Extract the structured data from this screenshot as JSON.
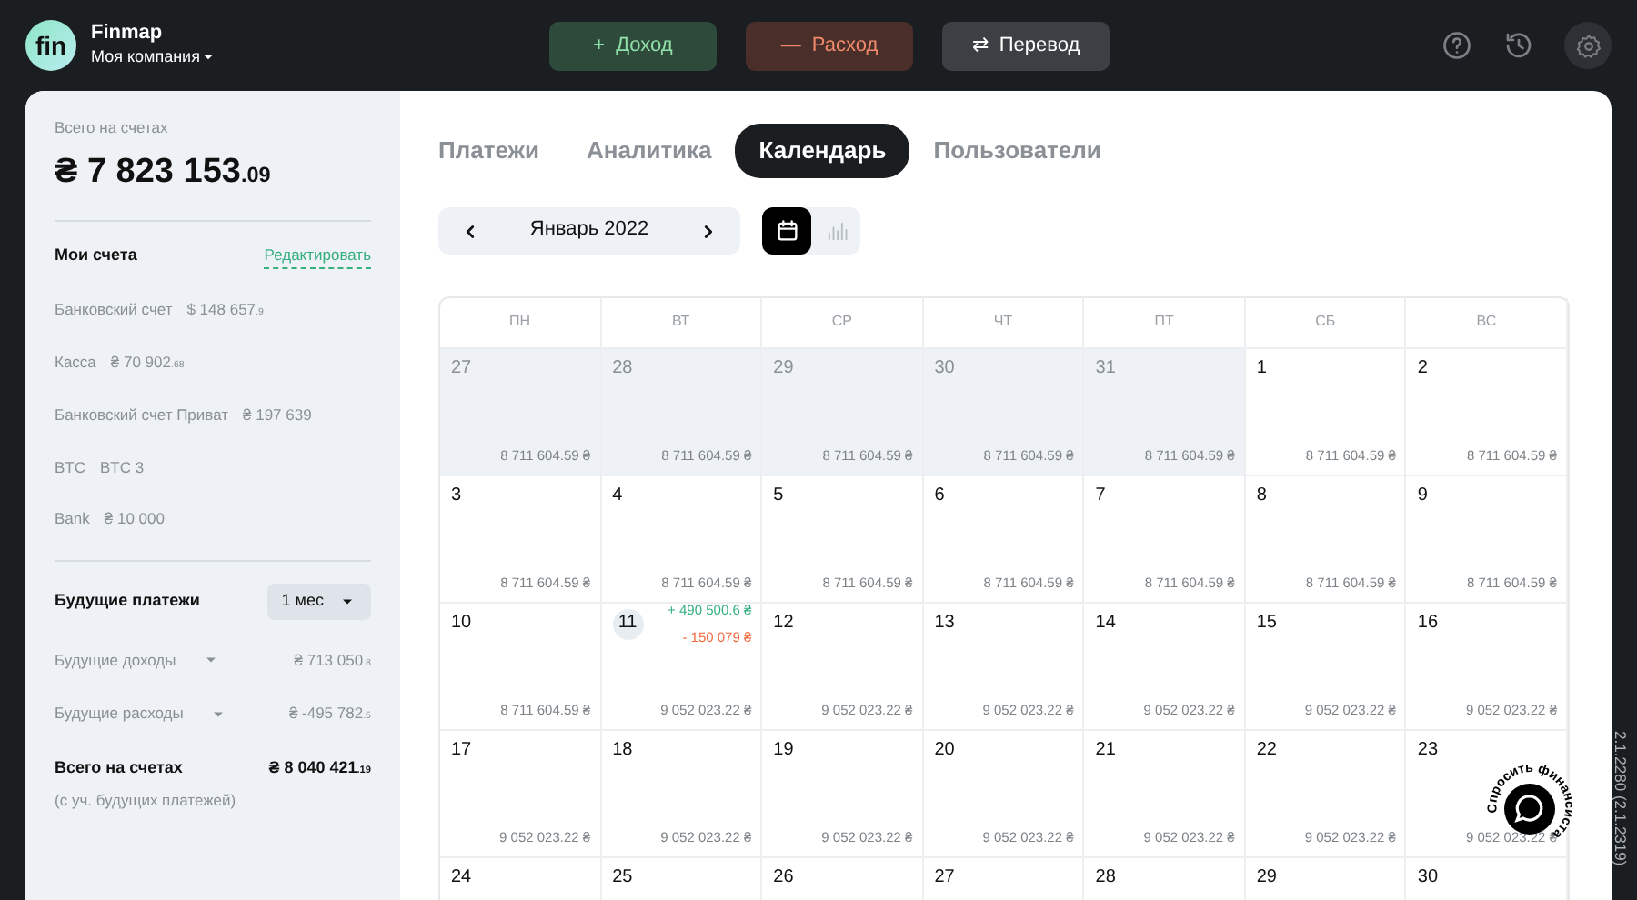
{
  "app": {
    "logo": "fin",
    "name": "Finmap",
    "company": "Моя компания"
  },
  "actions": [
    {
      "kind": "income",
      "label": "Доход",
      "icon": "+"
    },
    {
      "kind": "expense",
      "label": "Расход",
      "icon": "—"
    },
    {
      "kind": "transfer",
      "label": "Перевод",
      "icon": "⇄"
    }
  ],
  "sidebar": {
    "total_label": "Всего на счетах",
    "total": "₴ 7 823 153",
    "total_cents": ".09",
    "accounts_title": "Мои счета",
    "edit_link": "Редактировать",
    "accounts": [
      {
        "name": "Банковский счет",
        "amount": "$ 148 657",
        "cents": ".9"
      },
      {
        "name": "Касса",
        "amount": "₴ 70 902",
        "cents": ".68"
      },
      {
        "name": "Банковский счет Приват",
        "amount": "₴ 197 639"
      },
      {
        "name": "BTC",
        "amount": "BTC 3"
      },
      {
        "name": "Bank",
        "amount": "₴ 10 000"
      }
    ],
    "future_title": "Будущие платежи",
    "period": "1 мес",
    "future": [
      {
        "label": "Будущие доходы",
        "amount": "₴ 713 050",
        "cents": ".8"
      },
      {
        "label": "Будущие расходы",
        "amount": "₴ -495 782",
        "cents": ".5"
      }
    ],
    "grand_label": "Всего на счетах",
    "grand": "₴ 8 040 421",
    "grand_cents": ".19",
    "grand_note": "(с уч. будущих платежей)"
  },
  "tabs": [
    {
      "label": "Платежи",
      "selected": false
    },
    {
      "label": "Аналитика",
      "selected": false
    },
    {
      "label": "Календарь",
      "selected": true
    },
    {
      "label": "Пользователи",
      "selected": false
    }
  ],
  "month": "Январь 2022",
  "views": [
    {
      "kind": "calendar",
      "selected": true
    },
    {
      "kind": "chart",
      "selected": false
    }
  ],
  "weekdays": [
    "ПН",
    "ВТ",
    "СР",
    "ЧТ",
    "ПТ",
    "СБ",
    "ВС"
  ],
  "weeks": [
    [
      {
        "day": "27",
        "outside": true,
        "balance": "8 711 604.59 ₴"
      },
      {
        "day": "28",
        "outside": true,
        "balance": "8 711 604.59 ₴"
      },
      {
        "day": "29",
        "outside": true,
        "balance": "8 711 604.59 ₴"
      },
      {
        "day": "30",
        "outside": true,
        "balance": "8 711 604.59 ₴"
      },
      {
        "day": "31",
        "outside": true,
        "balance": "8 711 604.59 ₴"
      },
      {
        "day": "1",
        "outside": false,
        "balance": "8 711 604.59 ₴"
      },
      {
        "day": "2",
        "outside": false,
        "balance": "8 711 604.59 ₴"
      }
    ],
    [
      {
        "day": "3",
        "outside": false,
        "balance": "8 711 604.59 ₴"
      },
      {
        "day": "4",
        "outside": false,
        "balance": "8 711 604.59 ₴"
      },
      {
        "day": "5",
        "outside": false,
        "balance": "8 711 604.59 ₴"
      },
      {
        "day": "6",
        "outside": false,
        "balance": "8 711 604.59 ₴"
      },
      {
        "day": "7",
        "outside": false,
        "balance": "8 711 604.59 ₴"
      },
      {
        "day": "8",
        "outside": false,
        "balance": "8 711 604.59 ₴"
      },
      {
        "day": "9",
        "outside": false,
        "balance": "8 711 604.59 ₴"
      }
    ],
    [
      {
        "day": "10",
        "outside": false,
        "balance": "8 711 604.59 ₴"
      },
      {
        "day": "11",
        "outside": false,
        "today": true,
        "income": "+ 490 500.6 ₴",
        "expense": "- 150 079 ₴",
        "balance": "9 052 023.22 ₴"
      },
      {
        "day": "12",
        "outside": false,
        "balance": "9 052 023.22 ₴"
      },
      {
        "day": "13",
        "outside": false,
        "balance": "9 052 023.22 ₴"
      },
      {
        "day": "14",
        "outside": false,
        "balance": "9 052 023.22 ₴"
      },
      {
        "day": "15",
        "outside": false,
        "balance": "9 052 023.22 ₴"
      },
      {
        "day": "16",
        "outside": false,
        "balance": "9 052 023.22 ₴"
      }
    ],
    [
      {
        "day": "17",
        "outside": false,
        "balance": "9 052 023.22 ₴"
      },
      {
        "day": "18",
        "outside": false,
        "balance": "9 052 023.22 ₴"
      },
      {
        "day": "19",
        "outside": false,
        "balance": "9 052 023.22 ₴"
      },
      {
        "day": "20",
        "outside": false,
        "balance": "9 052 023.22 ₴"
      },
      {
        "day": "21",
        "outside": false,
        "balance": "9 052 023.22 ₴"
      },
      {
        "day": "22",
        "outside": false,
        "balance": "9 052 023.22 ₴"
      },
      {
        "day": "23",
        "outside": false,
        "balance": "9 052 023.22 ₴"
      }
    ],
    [
      {
        "day": "24",
        "outside": false
      },
      {
        "day": "25",
        "outside": false
      },
      {
        "day": "26",
        "outside": false
      },
      {
        "day": "27",
        "outside": false
      },
      {
        "day": "28",
        "outside": false
      },
      {
        "day": "29",
        "outside": false
      },
      {
        "day": "30",
        "outside": false
      }
    ]
  ],
  "chat_label": "Спросить финансиста",
  "version": "2.1.2280 (2.1.2319)"
}
